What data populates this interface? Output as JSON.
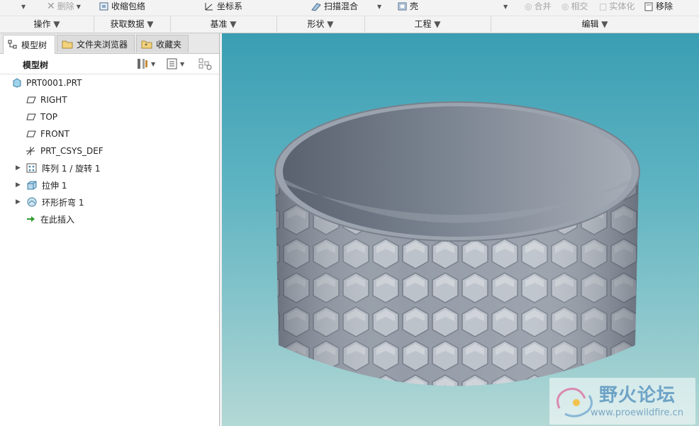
{
  "ribbon": {
    "row1": {
      "delete_label": "删除",
      "shrinkwrap_label": "收缩包络",
      "csys_label": "坐标系",
      "sweep_blend_label": "扫描混合",
      "shell_label": "壳",
      "merge_label": "合并",
      "intersect_label": "相交",
      "solidify_label": "实体化",
      "remove_label": "移除"
    },
    "groups": [
      {
        "label": "操作"
      },
      {
        "label": "获取数据"
      },
      {
        "label": "基准"
      },
      {
        "label": "形状"
      },
      {
        "label": "工程"
      },
      {
        "label": "编辑"
      }
    ]
  },
  "panel": {
    "tabs": [
      {
        "label": "模型树"
      },
      {
        "label": "文件夹浏览器"
      },
      {
        "label": "收藏夹"
      }
    ],
    "tree_title": "模型树",
    "nodes": [
      {
        "label": "PRT0001.PRT"
      },
      {
        "label": "RIGHT"
      },
      {
        "label": "TOP"
      },
      {
        "label": "FRONT"
      },
      {
        "label": "PRT_CSYS_DEF"
      },
      {
        "label": "阵列 1 / 旋转 1"
      },
      {
        "label": "拉伸 1"
      },
      {
        "label": "环形折弯 1"
      },
      {
        "label": "在此插入"
      }
    ]
  },
  "watermark": {
    "title": "野火论坛",
    "url": "www.proewildfire.cn"
  }
}
